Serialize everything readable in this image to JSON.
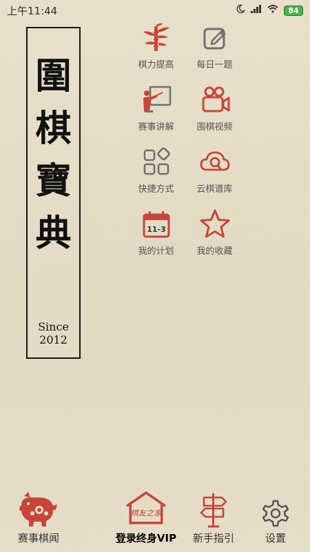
{
  "status_bar": {
    "time": "上午11:44",
    "battery": "84",
    "icons": [
      "moon-icon",
      "signal-icon",
      "wifi-icon",
      "battery-icon"
    ]
  },
  "title_panel": {
    "chars": [
      "圍",
      "棋",
      "寶",
      "典"
    ],
    "since": "Since 2012"
  },
  "features": [
    {
      "label": "棋力提高",
      "icon": "bamboo-icon"
    },
    {
      "label": "每日一题",
      "icon": "edit-note-icon"
    },
    {
      "label": "赛事讲解",
      "icon": "lecture-icon"
    },
    {
      "label": "围棋视频",
      "icon": "video-camera-icon"
    },
    {
      "label": "快捷方式",
      "icon": "shortcut-grid-icon"
    },
    {
      "label": "云棋谱库",
      "icon": "cloud-search-icon"
    },
    {
      "label": "我的计划",
      "icon": "calendar-icon"
    },
    {
      "label": "我的收藏",
      "icon": "star-icon"
    }
  ],
  "calendar_badge": "11-3",
  "bottom_nav": {
    "items": [
      {
        "label": "赛事棋闻",
        "icon": "paper-cut-pig-icon",
        "active": false
      },
      {
        "label": "登录终身VIP",
        "icon": "house-logo-icon",
        "active": true,
        "logo_text": "棋友之家"
      },
      {
        "label": "新手指引",
        "icon": "signpost-icon",
        "active": false
      },
      {
        "label": "设置",
        "icon": "gear-icon",
        "active": false
      }
    ]
  },
  "colors": {
    "accent_red": "#c8453b",
    "icon_gray": "#6f6f6f",
    "text_dark": "#111111",
    "background": "#e7ddc6"
  }
}
